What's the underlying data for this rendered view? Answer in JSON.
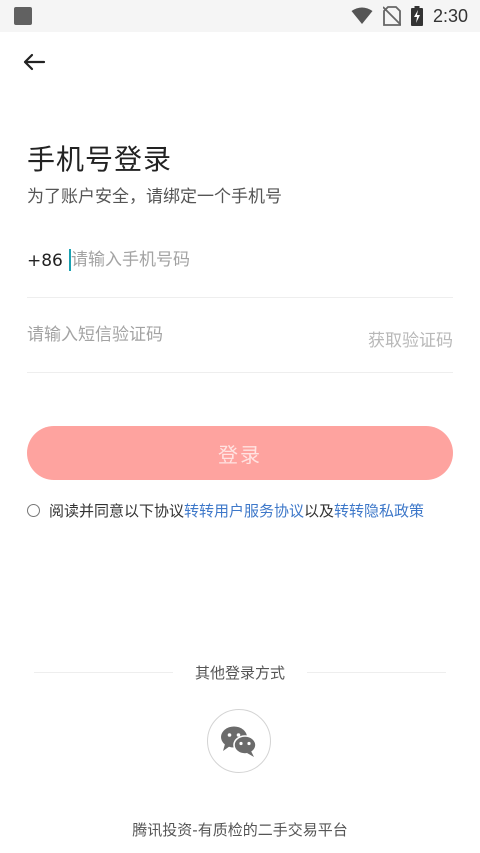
{
  "status_bar": {
    "time": "2:30"
  },
  "header": {
    "title": "手机号登录",
    "subtitle": "为了账户安全，请绑定一个手机号"
  },
  "phone": {
    "prefix": "+86",
    "placeholder": "请输入手机号码"
  },
  "code": {
    "placeholder": "请输入短信验证码",
    "get_code_label": "获取验证码"
  },
  "login_button": {
    "label": "登录"
  },
  "agreement": {
    "prefix": "阅读并同意以下协议",
    "link1": "转转用户服务协议",
    "joiner": "以及",
    "link2": "转转隐私政策"
  },
  "other_login": {
    "label": "其他登录方式"
  },
  "footer": {
    "text": "腾讯投资-有质检的二手交易平台"
  },
  "colors": {
    "login_button": "#fea39f",
    "link": "#3e78c9",
    "caret": "#1aa1b1"
  }
}
